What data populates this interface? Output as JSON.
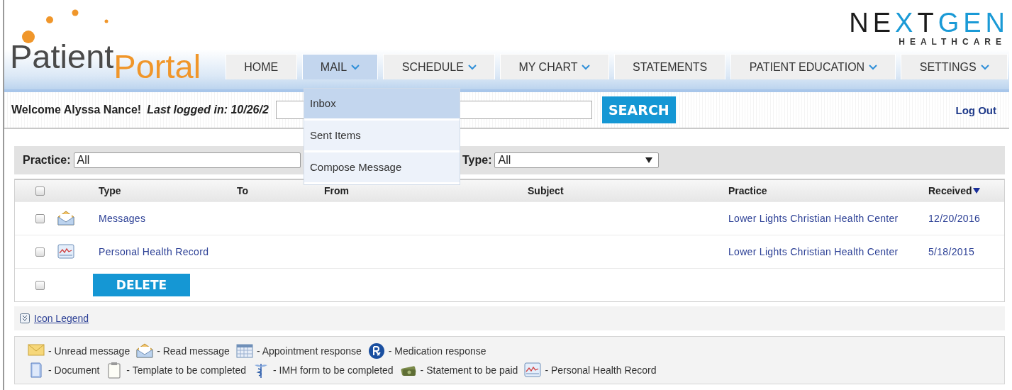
{
  "header": {
    "logo": {
      "first": "Patient",
      "second": "Portal"
    },
    "brand": {
      "parts": [
        {
          "text": "NE",
          "color": "#1b1b1b"
        },
        {
          "text": "X",
          "color": "#1a9ad6"
        },
        {
          "text": "T",
          "color": "#1b1b1b"
        },
        {
          "text": "GEN",
          "color": "#1a9ad6"
        }
      ],
      "tagline": "HEALTHCARE"
    }
  },
  "nav": {
    "tabs": [
      {
        "label": "HOME",
        "has_menu": false,
        "selected": false
      },
      {
        "label": "MAIL",
        "has_menu": true,
        "selected": true
      },
      {
        "label": "SCHEDULE",
        "has_menu": true,
        "selected": false
      },
      {
        "label": "MY CHART",
        "has_menu": true,
        "selected": false
      },
      {
        "label": "STATEMENTS",
        "has_menu": false,
        "selected": false
      },
      {
        "label": "PATIENT EDUCATION",
        "has_menu": true,
        "selected": false
      },
      {
        "label": "SETTINGS",
        "has_menu": true,
        "selected": false
      }
    ],
    "menu": [
      {
        "label": "Inbox",
        "selected": true
      },
      {
        "label": "Sent Items",
        "selected": false
      },
      {
        "label": "Compose Message",
        "selected": false
      }
    ]
  },
  "welcome": {
    "greeting": "Welcome Alyssa Nance!",
    "last_login": "Last logged in: 10/26/2",
    "search_button": "SEARCH",
    "logout": "Log Out"
  },
  "filters": [
    {
      "label": "Practice:",
      "value": "All",
      "arrow": false
    },
    {
      "label": "Type:",
      "value": "All",
      "arrow": true
    }
  ],
  "table": {
    "select_all_checked": false,
    "columns": [
      {
        "label": "Type",
        "sorted": false
      },
      {
        "label": "To",
        "sorted": false
      },
      {
        "label": "From",
        "sorted": false
      },
      {
        "label": "Subject",
        "sorted": false
      },
      {
        "label": "Practice",
        "sorted": false
      },
      {
        "label": "Received",
        "sorted": true
      }
    ],
    "rows": [
      {
        "checked": false,
        "kind": "read",
        "type": "Messages",
        "practice": "Lower Lights Christian Health Center",
        "received": "12/20/2016"
      },
      {
        "checked": false,
        "kind": "chart",
        "type": "Personal Health Record",
        "practice": "Lower Lights Christian Health Center",
        "received": "5/18/2015"
      }
    ],
    "footer": {
      "checked": false,
      "delete_button": "DELETE"
    }
  },
  "legend": {
    "toggle": "Icon Legend",
    "lines": [
      [
        {
          "kind": "unread",
          "label": "- Unread message"
        },
        {
          "kind": "read",
          "label": "- Read message"
        },
        {
          "kind": "calendar",
          "label": "- Appointment response"
        },
        {
          "kind": "rx",
          "label": "- Medication response"
        }
      ],
      [
        {
          "kind": "document",
          "label": "- Document"
        },
        {
          "kind": "clipboard",
          "label": "- Template to be completed"
        },
        {
          "kind": "caduceus",
          "label": "- IMH form to be completed"
        },
        {
          "kind": "money",
          "label": "- Statement to be paid"
        },
        {
          "kind": "chart",
          "label": "- Personal Health Record"
        }
      ]
    ]
  }
}
